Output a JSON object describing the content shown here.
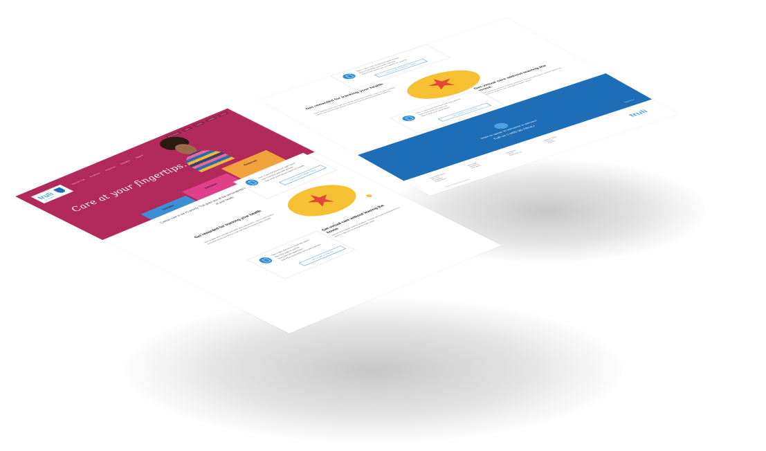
{
  "brand": {
    "name": "truli",
    "sub": "for health"
  },
  "nav": [
    "Discover Truli",
    "Enrollment",
    "Resources",
    "Education",
    "Support"
  ],
  "topbar": [
    "Find a Doctor",
    "Log In",
    "Contact",
    "Español",
    "Search"
  ],
  "hero": {
    "tagline": "Care at your fingertips."
  },
  "tabs": [
    "Overview",
    "Education",
    "Resources"
  ],
  "intro": "Custom care is our #1 priority. Truli gives you all the personalized tools you need to stay on top of your health.",
  "features": {
    "tracking_title": "Get rewarded for tracking your health",
    "tracking_body": "Earn rewards when you track your health goals and activities. Log in to your member portal and connect your device to start earning points toward healthy rewards.",
    "virtual_title": "Get virtual care without leaving the house",
    "virtual_body": "Get care from a doctor anytime, anywhere. Connect with board-certified doctors by phone or video for non-emergency health issues."
  },
  "card_top": {
    "step1": "Step 1 Log in and access your health tracker",
    "step2": "Step 2 Complete your health activities",
    "step3": "Step 3 Earn points you can redeem for rewards",
    "button": "Log in to use the Health Tracker"
  },
  "card_bottom": {
    "step1": "Step 1 Log in and view the virtual care options",
    "step2": "Step 2 Get ready for your visit",
    "step3": "Step 3 Start your appointment",
    "step4": "Step 4 Get a prescription sent to your pharmacy",
    "button": "Log in to start a virtual visit"
  },
  "contact": {
    "line1": "Want to speak to someone in person?",
    "line2": "Call us 1-855-35-TRULI",
    "tag": "Discover"
  },
  "footer": {
    "col1": [
      "DISCOVER TRULI",
      "Why Truli",
      "Enrollment",
      "Plan Options"
    ],
    "col2": [
      "EXPLORE",
      "Resources",
      "Education"
    ],
    "col3": [
      "MEMBERS",
      "Log In",
      "Find a Doctor"
    ],
    "col4": [
      "ABOUT TRULI",
      "Contact",
      "Careers"
    ],
    "copy": "Terms of Use    Privacy Notice"
  },
  "colors": {
    "magenta": "#b22a5b",
    "blue": "#1d6db7",
    "yellow": "#f5c132",
    "star": "#e5453a"
  }
}
